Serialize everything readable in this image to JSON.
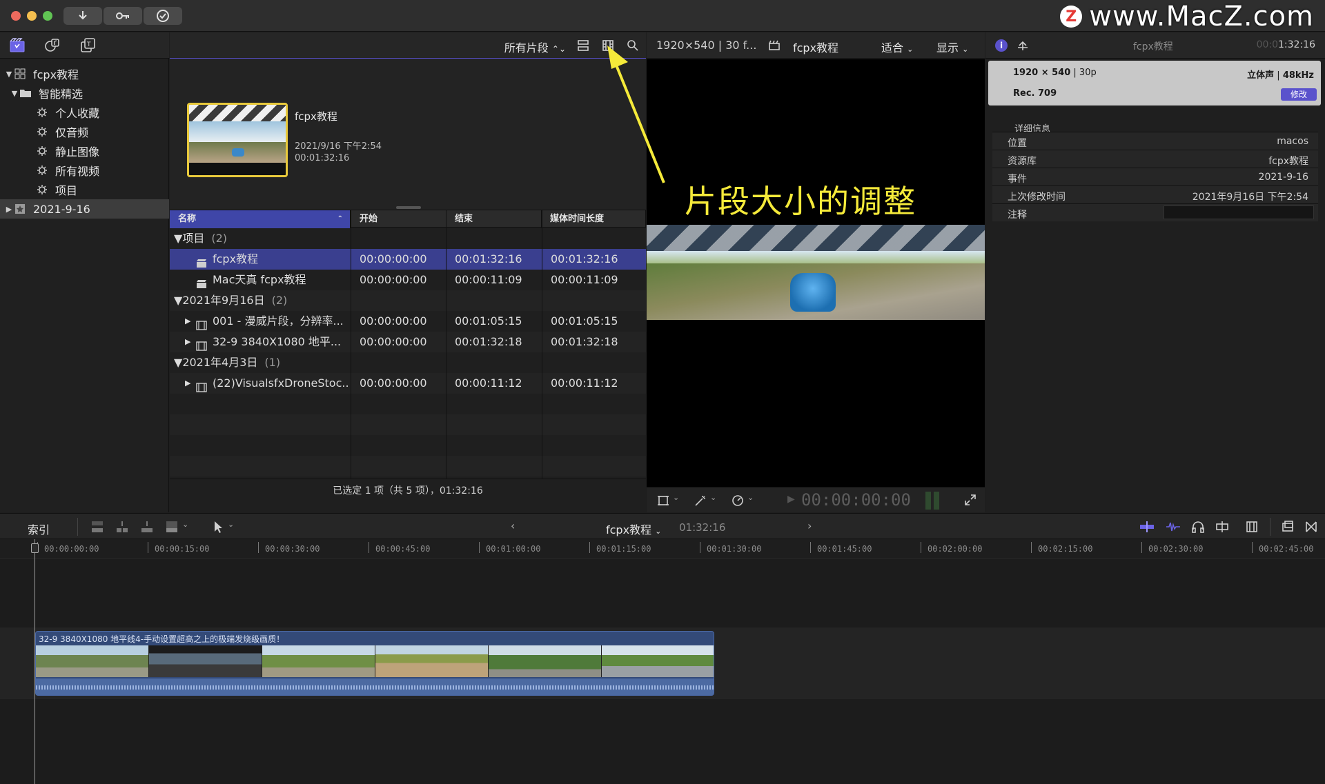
{
  "watermark": {
    "text": "www.MacZ.com",
    "logo_letter": "Z"
  },
  "titlebar": {
    "buttons": [
      "download-icon",
      "key-icon",
      "checkmark-icon"
    ]
  },
  "library_panel": {
    "icons": [
      "libraries-icon",
      "photos-audio-icon",
      "titles-generators-icon"
    ],
    "items": [
      {
        "label": "fcpx教程",
        "disclosure": "▼",
        "icon": "library-icon",
        "level": 0,
        "selected": false
      },
      {
        "label": "智能精选",
        "disclosure": "▼",
        "icon": "folder-icon",
        "level": 1,
        "selected": false
      },
      {
        "label": "个人收藏",
        "disclosure": "",
        "icon": "gear-icon",
        "level": 2,
        "selected": false
      },
      {
        "label": "仅音频",
        "disclosure": "",
        "icon": "gear-icon",
        "level": 2,
        "selected": false
      },
      {
        "label": "静止图像",
        "disclosure": "",
        "icon": "gear-icon",
        "level": 2,
        "selected": false
      },
      {
        "label": "所有视频",
        "disclosure": "",
        "icon": "gear-icon",
        "level": 2,
        "selected": false
      },
      {
        "label": "项目",
        "disclosure": "",
        "icon": "gear-icon",
        "level": 2,
        "selected": false
      },
      {
        "label": "2021-9-16",
        "disclosure": "▶",
        "icon": "event-star-icon",
        "level": 0,
        "selected": true
      }
    ]
  },
  "browser": {
    "filter_label": "所有片段",
    "filmstrip": {
      "title": "fcpx教程",
      "date": "2021/9/16 下午2:54",
      "duration": "00:01:32:16"
    },
    "columns": [
      "名称",
      "开始",
      "结束",
      "媒体时间长度"
    ],
    "rows": [
      {
        "type": "group",
        "name": "项目",
        "count": "(2)"
      },
      {
        "type": "item",
        "name": "fcpx教程",
        "start": "00:00:00:00",
        "end": "00:01:32:16",
        "duration": "00:01:32:16",
        "selected": true,
        "icon": "clapper-icon",
        "expand": ""
      },
      {
        "type": "item",
        "name": "Mac天真 fcpx教程",
        "start": "00:00:00:00",
        "end": "00:00:11:09",
        "duration": "00:00:11:09",
        "selected": false,
        "icon": "clapper-icon",
        "expand": ""
      },
      {
        "type": "group",
        "name": "2021年9月16日",
        "count": "(2)"
      },
      {
        "type": "item",
        "name": "001 - 漫威片段，分辨率...",
        "start": "00:00:00:00",
        "end": "00:01:05:15",
        "duration": "00:01:05:15",
        "selected": false,
        "icon": "film-icon",
        "expand": "▶"
      },
      {
        "type": "item",
        "name": "32-9 3840X1080 地平...",
        "start": "00:00:00:00",
        "end": "00:01:32:18",
        "duration": "00:01:32:18",
        "selected": false,
        "icon": "film-icon",
        "expand": "▶"
      },
      {
        "type": "group",
        "name": "2021年4月3日",
        "count": "(1)"
      },
      {
        "type": "item",
        "name": "(22)VisualsfxDroneStoc...",
        "start": "00:00:00:00",
        "end": "00:00:11:12",
        "duration": "00:00:11:12",
        "selected": false,
        "icon": "film-icon",
        "expand": "▶"
      }
    ],
    "status": "已选定 1 项（共 5 项），01:32:16"
  },
  "viewer": {
    "format": "1920×540 | 30 f...",
    "project": "fcpx教程",
    "zoom": "适合",
    "display": "显示",
    "timecode": "00:00:00:00",
    "overlay": "片段大小的调整"
  },
  "inspector": {
    "title": "fcpx教程",
    "timecode_dim": "00:0",
    "timecode": "1:32:16",
    "summary": {
      "resolution": "1920 × 540",
      "rate": "30p",
      "audio": "立体声",
      "sample": "48kHz",
      "color_space": "Rec. 709",
      "modify_label": "修改"
    },
    "section": "详细信息",
    "properties": [
      {
        "key": "位置",
        "value": "macos"
      },
      {
        "key": "资源库",
        "value": "fcpx教程"
      },
      {
        "key": "事件",
        "value": "2021-9-16"
      },
      {
        "key": "上次修改时间",
        "value": "2021年9月16日 下午2:54"
      },
      {
        "key": "注释",
        "value": ""
      }
    ]
  },
  "timeline": {
    "index_label": "索引",
    "project": "fcpx教程",
    "duration": "01:32:16",
    "ruler": [
      "00:00:00:00",
      "00:00:15:00",
      "00:00:30:00",
      "00:00:45:00",
      "00:01:00:00",
      "00:01:15:00",
      "00:01:30:00",
      "00:01:45:00",
      "00:02:00:00",
      "00:02:15:00",
      "00:02:30:00",
      "00:02:45:00"
    ],
    "clip_title": "32-9 3840X1080 地平线4-手动设置超高之上的极端发烧级画质！",
    "accent": "#5a52cc"
  }
}
